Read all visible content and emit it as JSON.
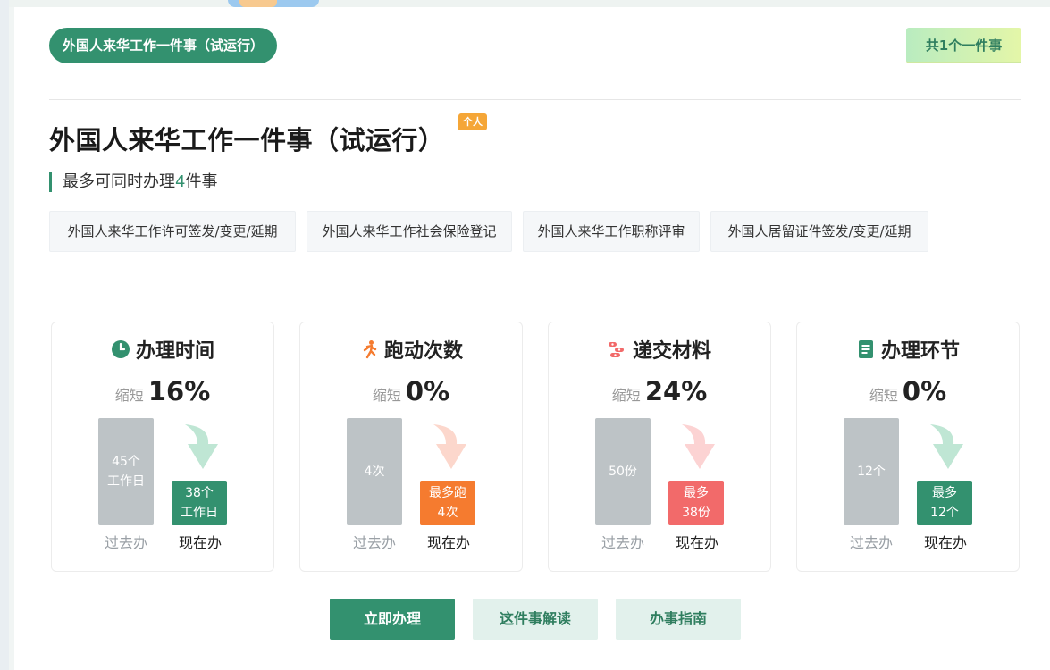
{
  "header": {
    "pill_title": "外国人来华工作一件事（试运行）",
    "count_badge": "共1个一件事"
  },
  "main": {
    "title": "外国人来华工作一件事（试运行）",
    "tag": "个人",
    "subtitle_prefix": "最多可同时办理",
    "subtitle_number": "4",
    "subtitle_suffix": "件事"
  },
  "chips": [
    "外国人来华工作许可签发/变更/延期",
    "外国人来华工作社会保险登记",
    "外国人来华工作职称评审",
    "外国人居留证件签发/变更/延期"
  ],
  "stats": [
    {
      "label": "办理时间",
      "icon": "clock-icon",
      "reduce_prefix": "缩短",
      "reduce_value": "16%",
      "past_line1": "45个",
      "past_line2": "工作日",
      "now_line1": "38个",
      "now_line2": "工作日",
      "past_caption": "过去办",
      "now_caption": "现在办",
      "color": "#33916f",
      "arrow_color": "#bfe6d4"
    },
    {
      "label": "跑动次数",
      "icon": "running-person-icon",
      "reduce_prefix": "缩短",
      "reduce_value": "0%",
      "past_line1": "4次",
      "past_line2": "",
      "now_line1": "最多跑",
      "now_line2": "4次",
      "past_caption": "过去办",
      "now_caption": "现在办",
      "color": "#f57b2f",
      "arrow_color": "#fcd7cc"
    },
    {
      "label": "递交材料",
      "icon": "documents-icon",
      "reduce_prefix": "缩短",
      "reduce_value": "24%",
      "past_line1": "50份",
      "past_line2": "",
      "now_line1": "最多",
      "now_line2": "38份",
      "past_caption": "过去办",
      "now_caption": "现在办",
      "color": "#f26a6a",
      "arrow_color": "#fcd3d3"
    },
    {
      "label": "办理环节",
      "icon": "list-doc-icon",
      "reduce_prefix": "缩短",
      "reduce_value": "0%",
      "past_line1": "12个",
      "past_line2": "",
      "now_line1": "最多",
      "now_line2": "12个",
      "past_caption": "过去办",
      "now_caption": "现在办",
      "color": "#33916f",
      "arrow_color": "#bfe6d4"
    }
  ],
  "actions": {
    "primary": "立即办理",
    "interpret": "这件事解读",
    "guide": "办事指南"
  }
}
